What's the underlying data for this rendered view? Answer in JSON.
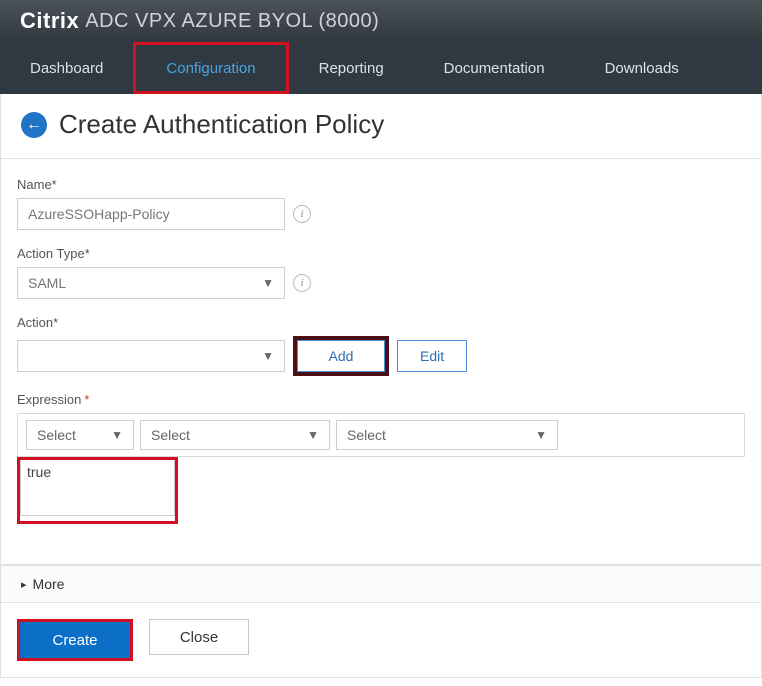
{
  "header": {
    "brand_bold": "Citrix",
    "brand_rest": "ADC VPX AZURE BYOL (8000)"
  },
  "nav": {
    "dashboard": "Dashboard",
    "configuration": "Configuration",
    "reporting": "Reporting",
    "documentation": "Documentation",
    "downloads": "Downloads"
  },
  "page": {
    "title": "Create Authentication Policy"
  },
  "fields": {
    "name_label": "Name*",
    "name_value": "AzureSSOHapp-Policy",
    "action_type_label": "Action Type*",
    "action_type_value": "SAML",
    "action_label": "Action*",
    "action_value": "",
    "add_btn": "Add",
    "edit_btn": "Edit",
    "expression_label": "Expression",
    "select_placeholder": "Select",
    "expression_value": "true"
  },
  "more": {
    "label": "More"
  },
  "footer": {
    "create": "Create",
    "close": "Close"
  }
}
